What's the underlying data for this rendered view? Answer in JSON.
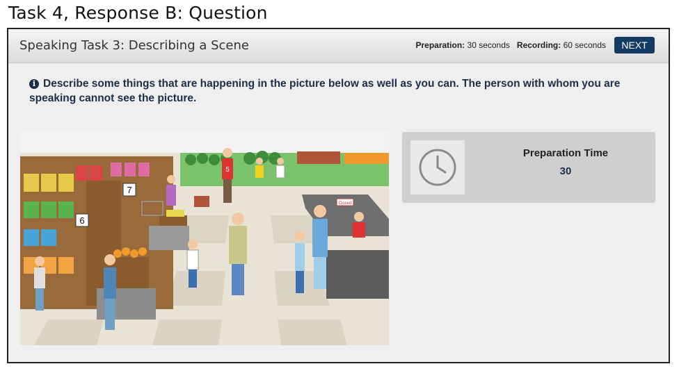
{
  "caption": "Task 4, Response B: Question",
  "header": {
    "title": "Speaking Task 3: Describing a Scene",
    "preparation_label": "Preparation:",
    "preparation_value": "30 seconds",
    "recording_label": "Recording:",
    "recording_value": "60 seconds",
    "next_label": "NEXT"
  },
  "instruction": {
    "icon": "info-icon",
    "text": "Describe some things that are happening in the picture below as well as you can. The person with whom you are speaking cannot see the picture."
  },
  "scene": {
    "aisle_labels": [
      "7",
      "6"
    ],
    "sign_text": "Closed",
    "shirt_number": "5"
  },
  "prep_panel": {
    "icon": "clock-icon",
    "label": "Preparation Time",
    "value": "30"
  },
  "colors": {
    "next_button": "#153a63",
    "instruction_text": "#1c2e4a"
  }
}
